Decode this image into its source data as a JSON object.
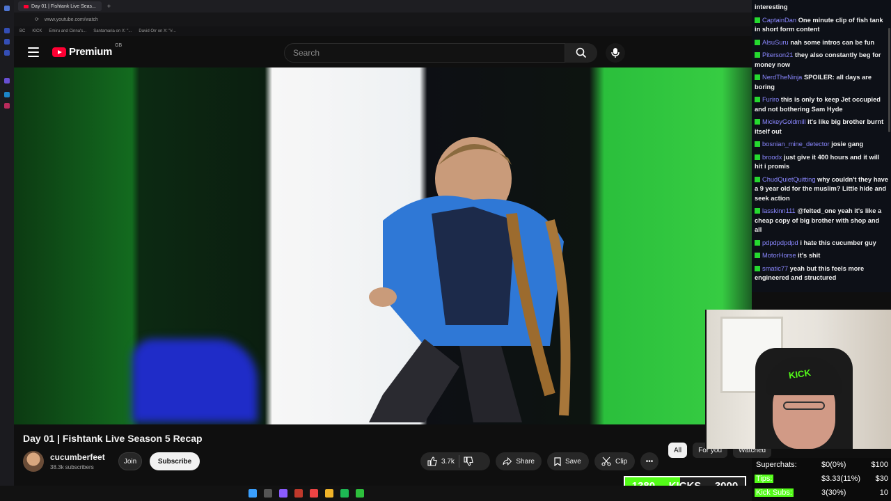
{
  "browser": {
    "tabs": [
      {
        "label": "Day 01 | Fishtank Live Seas..."
      }
    ],
    "url": "www.youtube.com/watch",
    "bookmarks": [
      "BC",
      "KICK",
      "Emiru and Cinna's...",
      "Santamaria on X: \"...",
      "David Orr on X: \"#..."
    ]
  },
  "header": {
    "logo_text": "Premium",
    "region": "GB",
    "search_placeholder": "Search",
    "icons": [
      "menu-icon",
      "search-icon",
      "mic-icon"
    ]
  },
  "video": {
    "title": "Day 01 | Fishtank Live Season 5 Recap",
    "channel": "cucumberfeet",
    "subscribers": "38.3k subscribers",
    "join_label": "Join",
    "subscribe_label": "Subscribe",
    "likes": "3.7k",
    "share_label": "Share",
    "save_label": "Save",
    "clip_label": "Clip"
  },
  "chips": [
    "All",
    "For you",
    "Watched"
  ],
  "chat": [
    {
      "user": "",
      "text": "interesting"
    },
    {
      "user": "CaptainDan",
      "text": "One minute clip of fish tank in short form content"
    },
    {
      "user": "AlsuSuru",
      "text": "nah some intros can be fun"
    },
    {
      "user": "Piterson21",
      "text": "they also constantly beg for money now"
    },
    {
      "user": "NerdTheNinja",
      "text": "SPOILER: all days are boring"
    },
    {
      "user": "Furiro",
      "text": "this is only to keep Jet occupied and not bothering Sam Hyde"
    },
    {
      "user": "MickeyGoldmill",
      "text": "it's like big brother burnt itself out"
    },
    {
      "user": "bosnian_mine_detector",
      "text": "josie gang"
    },
    {
      "user": "broodx",
      "text": "just give it 400 hours and it will hit i promis"
    },
    {
      "user": "ChudQuietQuitting",
      "text": "why couldn't they have a 9 year old for the muslim? Little hide and seek action"
    },
    {
      "user": "lasskinn111",
      "text": "@felted_one yeah it's like a cheap copy of big brother with shop and all"
    },
    {
      "user": "pdpdpdpdpd",
      "text": "i hate this cucumber guy"
    },
    {
      "user": "MotorHorse",
      "text": "it's shit"
    },
    {
      "user": "smatic77",
      "text": "yeah but this feels more engineered and structured"
    }
  ],
  "webcam": {
    "cap_text": "KICK"
  },
  "kick_goal": {
    "current": "1380",
    "label": "KICKS",
    "goal": "3000",
    "progress": 0.46
  },
  "stats": [
    {
      "label": "Superchats:",
      "value": "$0(0%)",
      "goal": "$100",
      "highlight": false
    },
    {
      "label": "Tips:",
      "value": "$3.33(11%)",
      "goal": "$30",
      "highlight": true
    },
    {
      "label": "Kick Subs:",
      "value": "3(30%)",
      "goal": "10",
      "highlight": true
    }
  ],
  "colors": {
    "accent_red": "#ff0033",
    "kick_green": "#53fc18",
    "chat_user": "#8a87ff"
  }
}
